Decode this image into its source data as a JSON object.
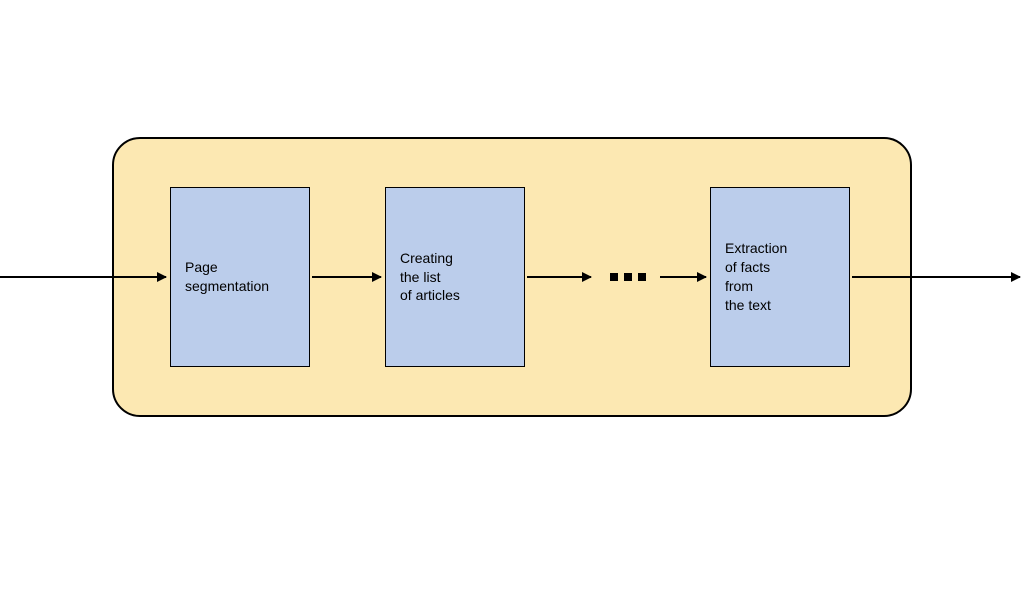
{
  "stages": {
    "s1": "Page\nsegmentation",
    "s2": "Creating\nthe list\nof articles",
    "s3": "Extraction\nof facts\nfrom\nthe text"
  },
  "ellipsis": "…",
  "colors": {
    "container": "#FCE8B2",
    "box": "#BBCDEB",
    "stroke": "#000000"
  }
}
